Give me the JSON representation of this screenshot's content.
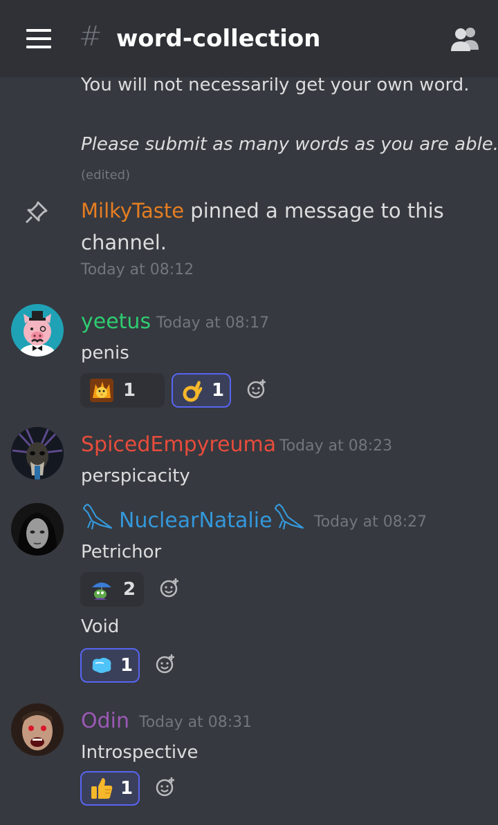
{
  "header": {
    "hash": "#",
    "channel_name": "word-collection"
  },
  "messages": {
    "prev": {
      "line1": "You will not necessarily get your own word.",
      "line2": "Please submit as many words as you are able.",
      "edited": "(edited)"
    },
    "system": {
      "user": "MilkyTaste",
      "text_a": " pinned a message to this",
      "text_b": "channel.",
      "timestamp": "Today at 08:12"
    },
    "m1": {
      "username": "yeetus",
      "timestamp": "Today at 08:17",
      "text": "penis",
      "reactions": [
        {
          "emoji": "custom-chick-emoji",
          "count": "1"
        },
        {
          "emoji": "ok-hand-emoji",
          "count": "1"
        }
      ]
    },
    "m2": {
      "username": "SpicedEmpyreuma",
      "timestamp": "Today at 08:23",
      "text": "perspicacity"
    },
    "m3": {
      "username": "NuclearNatalie",
      "timestamp": "Today at 08:27",
      "text1": "Petrichor",
      "text2": "Void",
      "reactions": [
        {
          "emoji": "pepe-umbrella-emoji",
          "count": "2"
        },
        {
          "emoji": "blue-blob-emoji",
          "count": "1"
        }
      ]
    },
    "m4": {
      "username": "Odin",
      "timestamp": "Today at 08:31",
      "text": "Introspective",
      "reactions": [
        {
          "emoji": "thumbs-up-emoji",
          "count": "1"
        }
      ]
    }
  },
  "colors": {
    "background": "#36393f",
    "header": "#2f3136",
    "milkytaste": "#e67e22",
    "yeetus": "#2ecc71",
    "spicedempyreuma": "#e74c3c",
    "nuclearnatalie": "#3498db",
    "odin": "#9b59b6",
    "accent": "#5865f2"
  }
}
